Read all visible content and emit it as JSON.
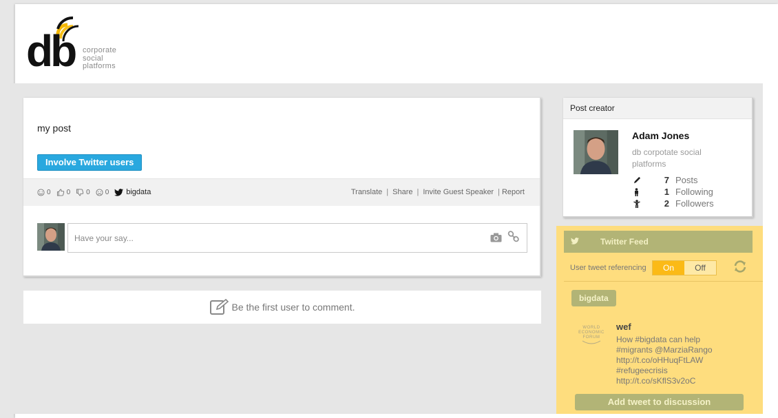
{
  "logo": {
    "mark": "db",
    "tagline": [
      "corporate",
      "social",
      "platforms"
    ]
  },
  "post": {
    "text": "my post",
    "involve_button": "Involve Twitter users",
    "reactions": [
      {
        "icon": "smile-icon",
        "count": "0"
      },
      {
        "icon": "thumbs-up-icon",
        "count": "0"
      },
      {
        "icon": "thumbs-down-icon",
        "count": "0"
      },
      {
        "icon": "sad-icon",
        "count": "0"
      }
    ],
    "hashtag": "bigdata",
    "actions": {
      "translate": "Translate",
      "share": "Share",
      "invite": "Invite Guest Speaker",
      "report": "Report"
    },
    "comment_placeholder": "Have your say...",
    "first_comment": "Be the first user to comment."
  },
  "creator": {
    "header": "Post creator",
    "name": "Adam Jones",
    "org": "db corpotate social platforms",
    "stats": [
      {
        "icon": "pencil-icon",
        "count": "7",
        "label": "Posts"
      },
      {
        "icon": "person-icon",
        "count": "1",
        "label": "Following"
      },
      {
        "icon": "person-arms-icon",
        "count": "2",
        "label": "Followers"
      }
    ]
  },
  "twitter": {
    "header": "Twitter Feed",
    "ref_label": "User tweet referencing",
    "toggle_on": "On",
    "toggle_off": "Off",
    "tag": "bigdata",
    "tweet": {
      "logo_lines": [
        "WORLD",
        "ECONOMIC",
        "FORUM"
      ],
      "user": "wef",
      "lines": [
        "How #bigdata can help",
        "#migrants @MarziaRango",
        "http://t.co/oHHuqFtLAW",
        "#refugeecrisis",
        "http://t.co/sKflS3v2oC"
      ]
    },
    "add_button": "Add tweet to discussion"
  },
  "colors": {
    "accent_blue": "#29a8df",
    "twitter_panel": "#fedd7e",
    "olive": "#b2b476",
    "toggle_on": "#fbba16"
  }
}
